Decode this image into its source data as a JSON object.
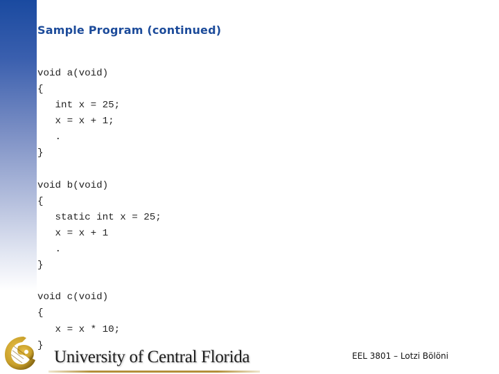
{
  "slide": {
    "title": "Sample Program (continued)",
    "code_lines": [
      "void a(void)",
      "{",
      "   int x = 25;",
      "   x = x + 1;",
      "   .",
      "}",
      "",
      "void b(void)",
      "{",
      "   static int x = 25;",
      "   x = x + 1",
      "   .",
      "}",
      "",
      "void c(void)",
      "{",
      "   x = x * 10;",
      "}"
    ]
  },
  "footer": {
    "university": "University of Central Florida",
    "course": "EEL 3801 – Lotzi Bölöni",
    "logo_icon": "pegasus-logo-icon"
  },
  "colors": {
    "title": "#1c4b9a",
    "sidebar_top": "#1a4aa0",
    "logo_gold": "#c9a02a"
  }
}
